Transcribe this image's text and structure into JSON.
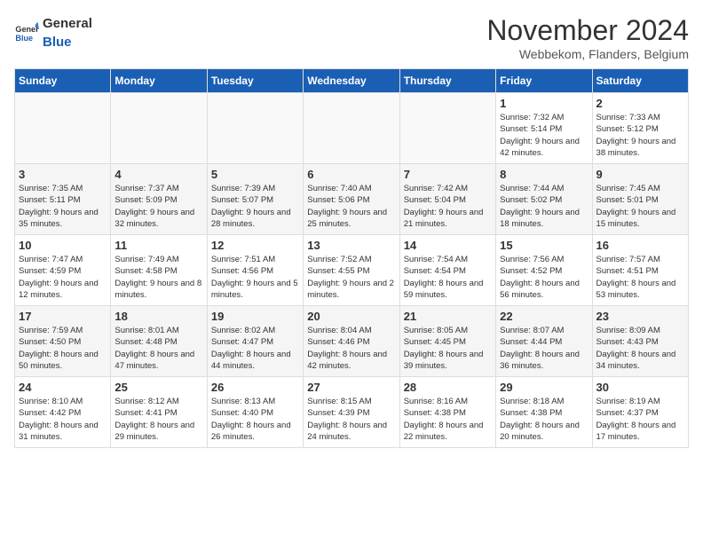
{
  "header": {
    "logo_general": "General",
    "logo_blue": "Blue",
    "month_title": "November 2024",
    "location": "Webbekom, Flanders, Belgium"
  },
  "days_of_week": [
    "Sunday",
    "Monday",
    "Tuesday",
    "Wednesday",
    "Thursday",
    "Friday",
    "Saturday"
  ],
  "weeks": [
    [
      {
        "day": "",
        "info": ""
      },
      {
        "day": "",
        "info": ""
      },
      {
        "day": "",
        "info": ""
      },
      {
        "day": "",
        "info": ""
      },
      {
        "day": "",
        "info": ""
      },
      {
        "day": "1",
        "info": "Sunrise: 7:32 AM\nSunset: 5:14 PM\nDaylight: 9 hours and 42 minutes."
      },
      {
        "day": "2",
        "info": "Sunrise: 7:33 AM\nSunset: 5:12 PM\nDaylight: 9 hours and 38 minutes."
      }
    ],
    [
      {
        "day": "3",
        "info": "Sunrise: 7:35 AM\nSunset: 5:11 PM\nDaylight: 9 hours and 35 minutes."
      },
      {
        "day": "4",
        "info": "Sunrise: 7:37 AM\nSunset: 5:09 PM\nDaylight: 9 hours and 32 minutes."
      },
      {
        "day": "5",
        "info": "Sunrise: 7:39 AM\nSunset: 5:07 PM\nDaylight: 9 hours and 28 minutes."
      },
      {
        "day": "6",
        "info": "Sunrise: 7:40 AM\nSunset: 5:06 PM\nDaylight: 9 hours and 25 minutes."
      },
      {
        "day": "7",
        "info": "Sunrise: 7:42 AM\nSunset: 5:04 PM\nDaylight: 9 hours and 21 minutes."
      },
      {
        "day": "8",
        "info": "Sunrise: 7:44 AM\nSunset: 5:02 PM\nDaylight: 9 hours and 18 minutes."
      },
      {
        "day": "9",
        "info": "Sunrise: 7:45 AM\nSunset: 5:01 PM\nDaylight: 9 hours and 15 minutes."
      }
    ],
    [
      {
        "day": "10",
        "info": "Sunrise: 7:47 AM\nSunset: 4:59 PM\nDaylight: 9 hours and 12 minutes."
      },
      {
        "day": "11",
        "info": "Sunrise: 7:49 AM\nSunset: 4:58 PM\nDaylight: 9 hours and 8 minutes."
      },
      {
        "day": "12",
        "info": "Sunrise: 7:51 AM\nSunset: 4:56 PM\nDaylight: 9 hours and 5 minutes."
      },
      {
        "day": "13",
        "info": "Sunrise: 7:52 AM\nSunset: 4:55 PM\nDaylight: 9 hours and 2 minutes."
      },
      {
        "day": "14",
        "info": "Sunrise: 7:54 AM\nSunset: 4:54 PM\nDaylight: 8 hours and 59 minutes."
      },
      {
        "day": "15",
        "info": "Sunrise: 7:56 AM\nSunset: 4:52 PM\nDaylight: 8 hours and 56 minutes."
      },
      {
        "day": "16",
        "info": "Sunrise: 7:57 AM\nSunset: 4:51 PM\nDaylight: 8 hours and 53 minutes."
      }
    ],
    [
      {
        "day": "17",
        "info": "Sunrise: 7:59 AM\nSunset: 4:50 PM\nDaylight: 8 hours and 50 minutes."
      },
      {
        "day": "18",
        "info": "Sunrise: 8:01 AM\nSunset: 4:48 PM\nDaylight: 8 hours and 47 minutes."
      },
      {
        "day": "19",
        "info": "Sunrise: 8:02 AM\nSunset: 4:47 PM\nDaylight: 8 hours and 44 minutes."
      },
      {
        "day": "20",
        "info": "Sunrise: 8:04 AM\nSunset: 4:46 PM\nDaylight: 8 hours and 42 minutes."
      },
      {
        "day": "21",
        "info": "Sunrise: 8:05 AM\nSunset: 4:45 PM\nDaylight: 8 hours and 39 minutes."
      },
      {
        "day": "22",
        "info": "Sunrise: 8:07 AM\nSunset: 4:44 PM\nDaylight: 8 hours and 36 minutes."
      },
      {
        "day": "23",
        "info": "Sunrise: 8:09 AM\nSunset: 4:43 PM\nDaylight: 8 hours and 34 minutes."
      }
    ],
    [
      {
        "day": "24",
        "info": "Sunrise: 8:10 AM\nSunset: 4:42 PM\nDaylight: 8 hours and 31 minutes."
      },
      {
        "day": "25",
        "info": "Sunrise: 8:12 AM\nSunset: 4:41 PM\nDaylight: 8 hours and 29 minutes."
      },
      {
        "day": "26",
        "info": "Sunrise: 8:13 AM\nSunset: 4:40 PM\nDaylight: 8 hours and 26 minutes."
      },
      {
        "day": "27",
        "info": "Sunrise: 8:15 AM\nSunset: 4:39 PM\nDaylight: 8 hours and 24 minutes."
      },
      {
        "day": "28",
        "info": "Sunrise: 8:16 AM\nSunset: 4:38 PM\nDaylight: 8 hours and 22 minutes."
      },
      {
        "day": "29",
        "info": "Sunrise: 8:18 AM\nSunset: 4:38 PM\nDaylight: 8 hours and 20 minutes."
      },
      {
        "day": "30",
        "info": "Sunrise: 8:19 AM\nSunset: 4:37 PM\nDaylight: 8 hours and 17 minutes."
      }
    ]
  ]
}
